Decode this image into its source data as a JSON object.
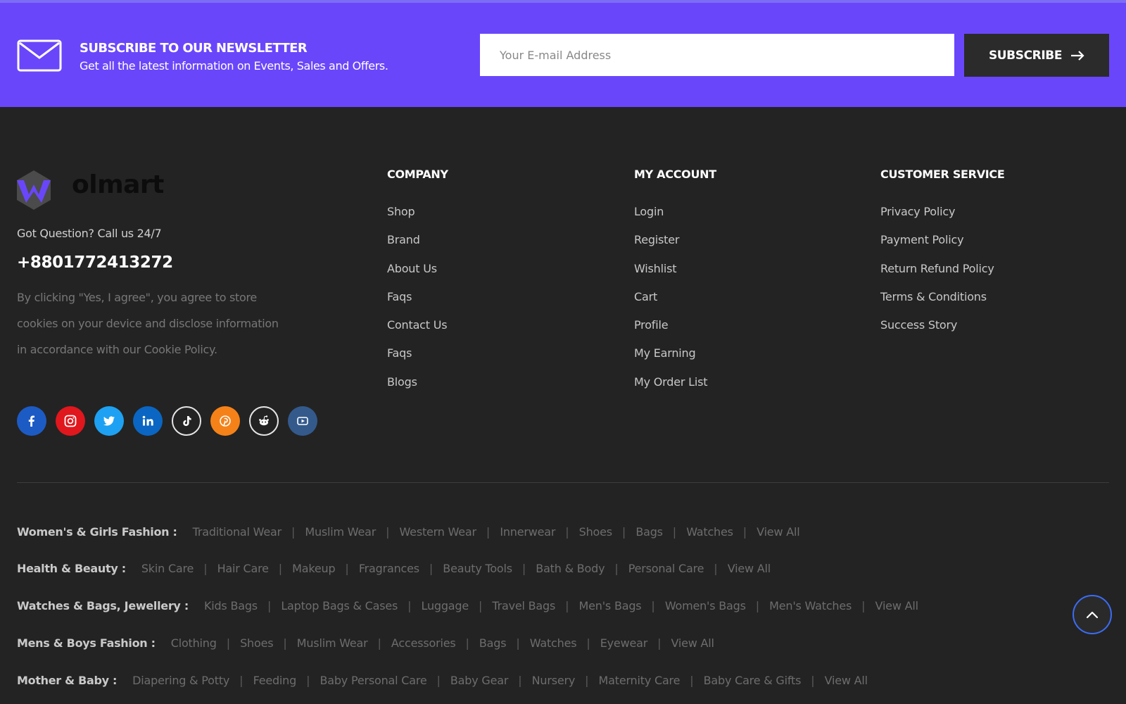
{
  "newsletter": {
    "title": "SUBSCRIBE TO OUR NEWSLETTER",
    "subtitle": "Get all the latest information on Events, Sales and Offers.",
    "email_placeholder": "Your E-mail Address",
    "button_label": "SUBSCRIBE",
    "bg_color": "#6a46fb"
  },
  "brand": {
    "logo_text": "olmart",
    "question": "Got Question? Call us 24/7",
    "phone": "+8801772413272",
    "consent": "By clicking \"Yes, I agree\", you agree to store cookies on your device and disclose information in accordance with our Cookie Policy."
  },
  "socials": [
    {
      "icon": "facebook-icon",
      "color": "#1d5bc4"
    },
    {
      "icon": "instagram-icon",
      "color": "#e0171d"
    },
    {
      "icon": "twitter-icon",
      "color": "#1ea1f2"
    },
    {
      "icon": "linkedin-icon",
      "color": "#0a66c2"
    },
    {
      "icon": "tiktok-icon",
      "color": "#232323"
    },
    {
      "icon": "pinterest-icon",
      "color": "#f58219"
    },
    {
      "icon": "reddit-icon",
      "color": "#232323"
    },
    {
      "icon": "youtube-icon",
      "color": "#345a8c"
    }
  ],
  "company": {
    "heading": "COMPANY",
    "links": [
      "Shop",
      "Brand",
      "About Us",
      "Faqs",
      "Contact Us",
      "Faqs",
      "Blogs"
    ]
  },
  "account": {
    "heading": "MY ACCOUNT",
    "links": [
      "Login",
      "Register",
      "Wishlist",
      "Cart",
      "Profile",
      "My Earning",
      "My Order List"
    ]
  },
  "service": {
    "heading": "CUSTOMER SERVICE",
    "links": [
      "Privacy Policy",
      "Payment Policy",
      "Return Refund Policy",
      "Terms & Conditions",
      "Success Story"
    ]
  },
  "categories": [
    {
      "label": "Women's & Girls Fashion :",
      "links": [
        "Traditional Wear",
        "Muslim Wear",
        "Western Wear",
        "Innerwear",
        "Shoes",
        "Bags",
        "Watches",
        "View All"
      ]
    },
    {
      "label": "Health & Beauty :",
      "links": [
        "Skin Care",
        "Hair Care",
        "Makeup",
        "Fragrances",
        "Beauty Tools",
        "Bath & Body",
        "Personal Care",
        "View All"
      ]
    },
    {
      "label": "Watches & Bags, Jewellery :",
      "links": [
        "Kids Bags",
        "Laptop Bags & Cases",
        "Luggage",
        "Travel Bags",
        "Men's Bags",
        "Women's Bags",
        "Men's Watches",
        "View All"
      ]
    },
    {
      "label": "Mens & Boys Fashion :",
      "links": [
        "Clothing",
        "Shoes",
        "Muslim Wear",
        "Accessories",
        "Bags",
        "Watches",
        "Eyewear",
        "View All"
      ]
    },
    {
      "label": "Mother & Baby :",
      "links": [
        "Diapering & Potty",
        "Feeding",
        "Baby Personal Care",
        "Baby Gear",
        "Nursery",
        "Maternity Care",
        "Baby Care & Gifts",
        "View All"
      ]
    }
  ]
}
